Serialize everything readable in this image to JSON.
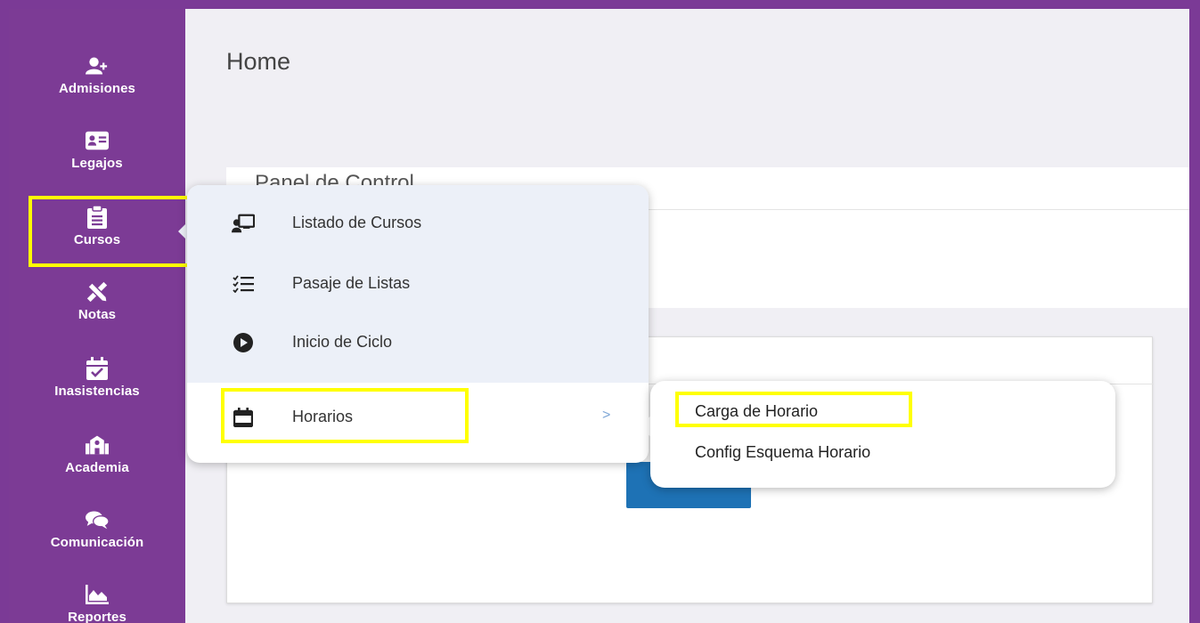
{
  "colors": {
    "sidebar": "#7c3b95",
    "highlight": "#ffff00",
    "primary_button": "#1e72b5",
    "menu_background": "#ecf0f8"
  },
  "sidebar": {
    "items": [
      {
        "label": "Admisiones",
        "icon": "user-plus-icon"
      },
      {
        "label": "Legajos",
        "icon": "id-card-icon"
      },
      {
        "label": "Cursos",
        "icon": "clipboard-icon",
        "active": true
      },
      {
        "label": "Notas",
        "icon": "ruler-pencil-icon"
      },
      {
        "label": "Inasistencias",
        "icon": "calendar-check-icon"
      },
      {
        "label": "Academia",
        "icon": "school-icon"
      },
      {
        "label": "Comunicación",
        "icon": "chat-bubbles-icon"
      },
      {
        "label": "Reportes",
        "icon": "area-chart-icon"
      }
    ]
  },
  "main": {
    "page_title": "Home",
    "panel_title": "Panel de Control"
  },
  "cursos_menu": {
    "items": [
      {
        "label": "Listado de Cursos",
        "icon": "teacher-board-icon"
      },
      {
        "label": "Pasaje de Listas",
        "icon": "checklist-icon"
      },
      {
        "label": "Inicio de Ciclo",
        "icon": "play-circle-icon"
      },
      {
        "label": "Horarios",
        "icon": "calendar-icon",
        "has_submenu": true
      }
    ],
    "chevron": ">"
  },
  "horarios_submenu": {
    "items": [
      {
        "label": "Carga de Horario",
        "highlighted": true
      },
      {
        "label": "Config Esquema Horario"
      }
    ]
  }
}
